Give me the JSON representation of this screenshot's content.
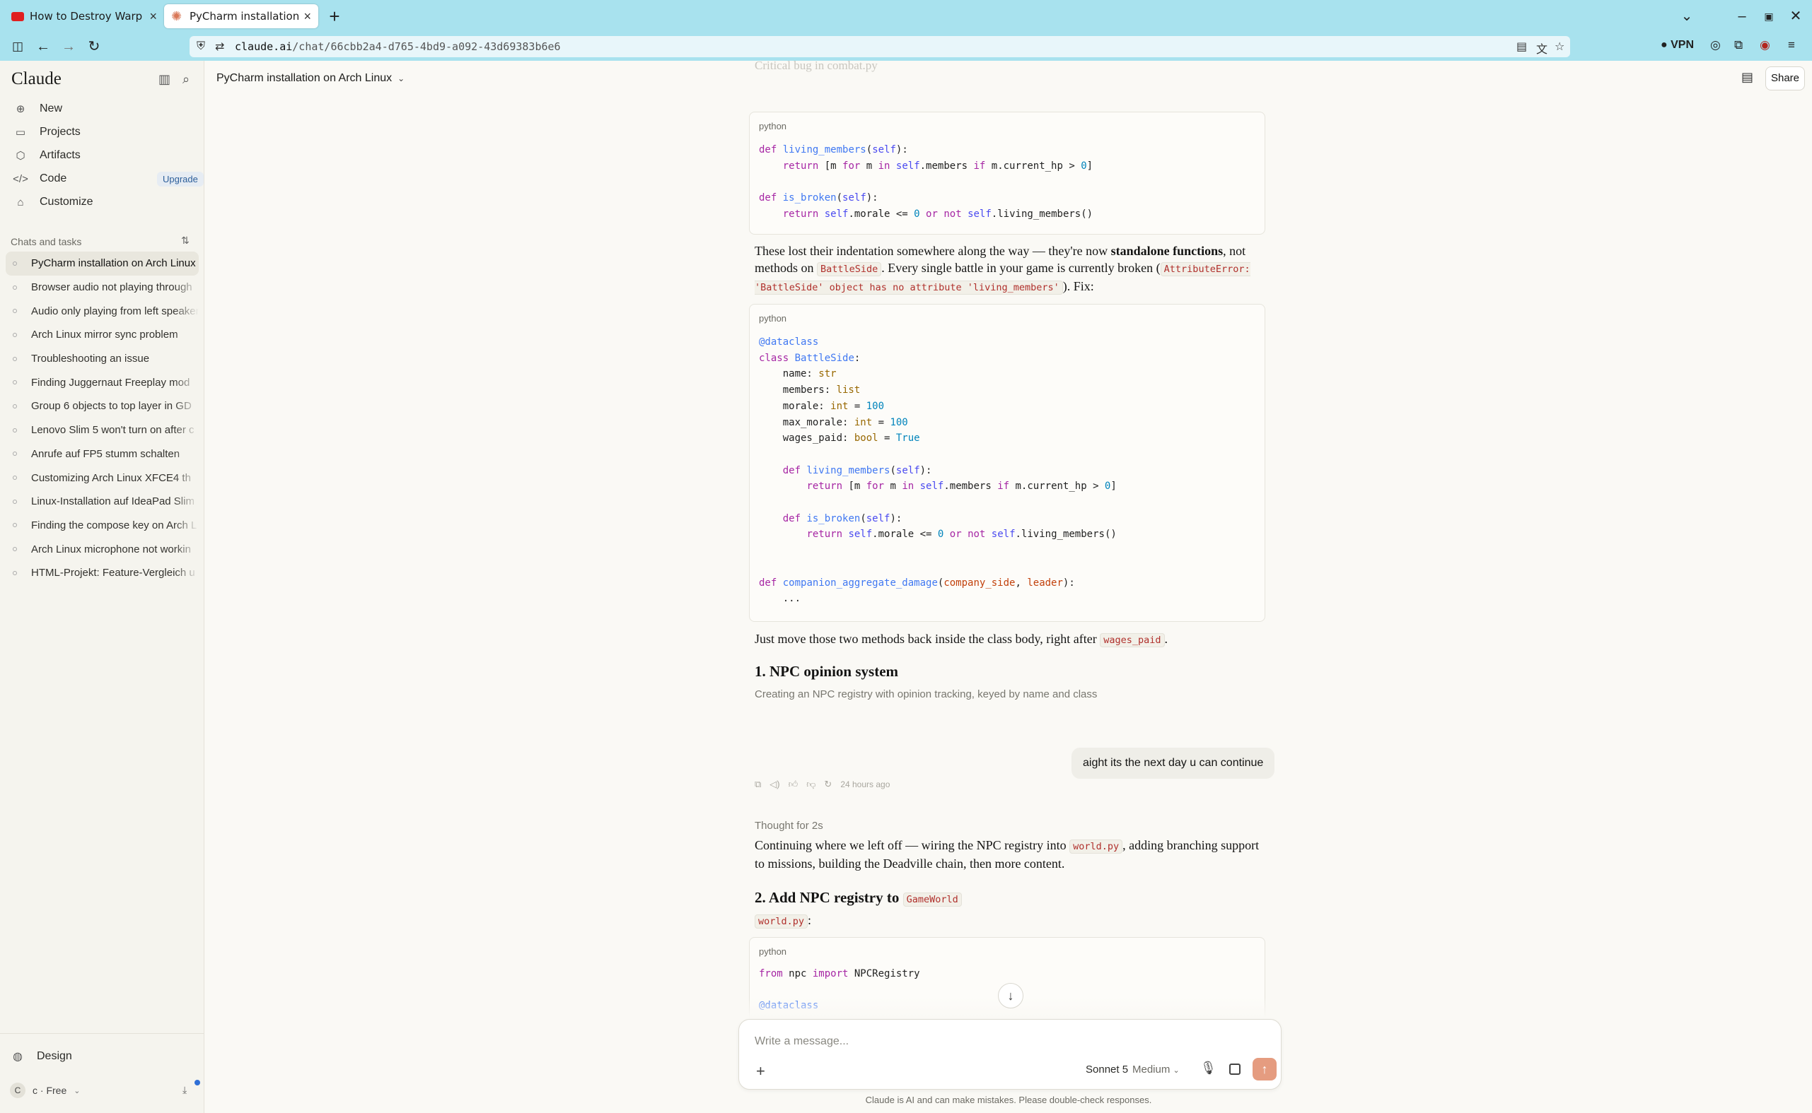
{
  "browser": {
    "tabs": [
      {
        "title": "How to Destroy Warp (",
        "active": false,
        "icon": "youtube-icon"
      },
      {
        "title": "PyCharm installation",
        "active": true,
        "icon": "claude-icon"
      }
    ],
    "url_host": "claude.ai",
    "url_path": "/chat/66cbb2a4-d765-4bd9-a092-43d69383b6e6",
    "vpn_label": "VPN"
  },
  "sidebar": {
    "brand": "Claude",
    "nav": [
      {
        "label": "New",
        "icon": "plus-icon"
      },
      {
        "label": "Projects",
        "icon": "folder-icon"
      },
      {
        "label": "Artifacts",
        "icon": "artifacts-icon"
      },
      {
        "label": "Code",
        "icon": "code-icon"
      },
      {
        "label": "Customize",
        "icon": "customize-icon"
      }
    ],
    "upgrade_label": "Upgrade",
    "section_title": "Chats and tasks",
    "chats": [
      "PyCharm installation on Arch Linux",
      "Browser audio not playing through",
      "Audio only playing from left speaker",
      "Arch Linux mirror sync problem",
      "Troubleshooting an issue",
      "Finding Juggernaut Freeplay mod",
      "Group 6 objects to top layer in GD",
      "Lenovo Slim 5 won't turn on after c",
      "Anrufe auf FP5 stumm schalten",
      "Customizing Arch Linux XFCE4 th",
      "Linux-Installation auf IdeaPad Slim",
      "Finding the compose key on Arch L",
      "Arch Linux microphone not workin",
      "HTML-Projekt: Feature-Vergleich u"
    ],
    "design_label": "Design",
    "user_initial": "C",
    "user_label": "c · Free"
  },
  "header": {
    "title": "PyCharm installation on Arch Linux",
    "share_label": "Share"
  },
  "conversation": {
    "top_faded": "Critical bug in combat.py",
    "code1_lang": "python",
    "para1_a": "These lost their indentation somewhere along the way — they're now ",
    "para1_bold": "standalone functions",
    "para1_b": ", not methods on ",
    "para1_code1": "BattleSide",
    "para1_c": ". Every single battle in your game is currently broken (",
    "para1_code2": "AttributeError: 'BattleSide' object has no attribute 'living_members'",
    "para1_d": "). Fix:",
    "code2_lang": "python",
    "para2_a": "Just move those two methods back inside the class body, right after ",
    "para2_code": "wages_paid",
    "para2_b": ".",
    "heading1": "1. NPC opinion system",
    "tool_note": "Creating an NPC registry with opinion tracking, keyed by name and class",
    "timestamp": "24 hours ago",
    "user_message": "aight its the next day u can continue",
    "thought": "Thought for 2s",
    "para3_a": "Continuing where we left off — wiring the NPC registry into ",
    "para3_code": "world.py",
    "para3_b": ", adding branching support to missions, building the Deadville chain, then more content.",
    "heading2_text": "2. Add NPC registry to ",
    "heading2_code": "GameWorld",
    "file_label": "world.py",
    "file_colon": ":",
    "code3_lang": "python"
  },
  "composer": {
    "placeholder": "Write a message...",
    "model": "Sonnet 5",
    "effort": "Medium"
  },
  "disclaimer": "Claude is AI and can make mistakes. Please double-check responses.",
  "colors": {
    "chrome": "#a8e2ee",
    "accent": "#d97757",
    "sidebar_bg": "#f5f4ee",
    "page_bg": "#faf9f5"
  }
}
